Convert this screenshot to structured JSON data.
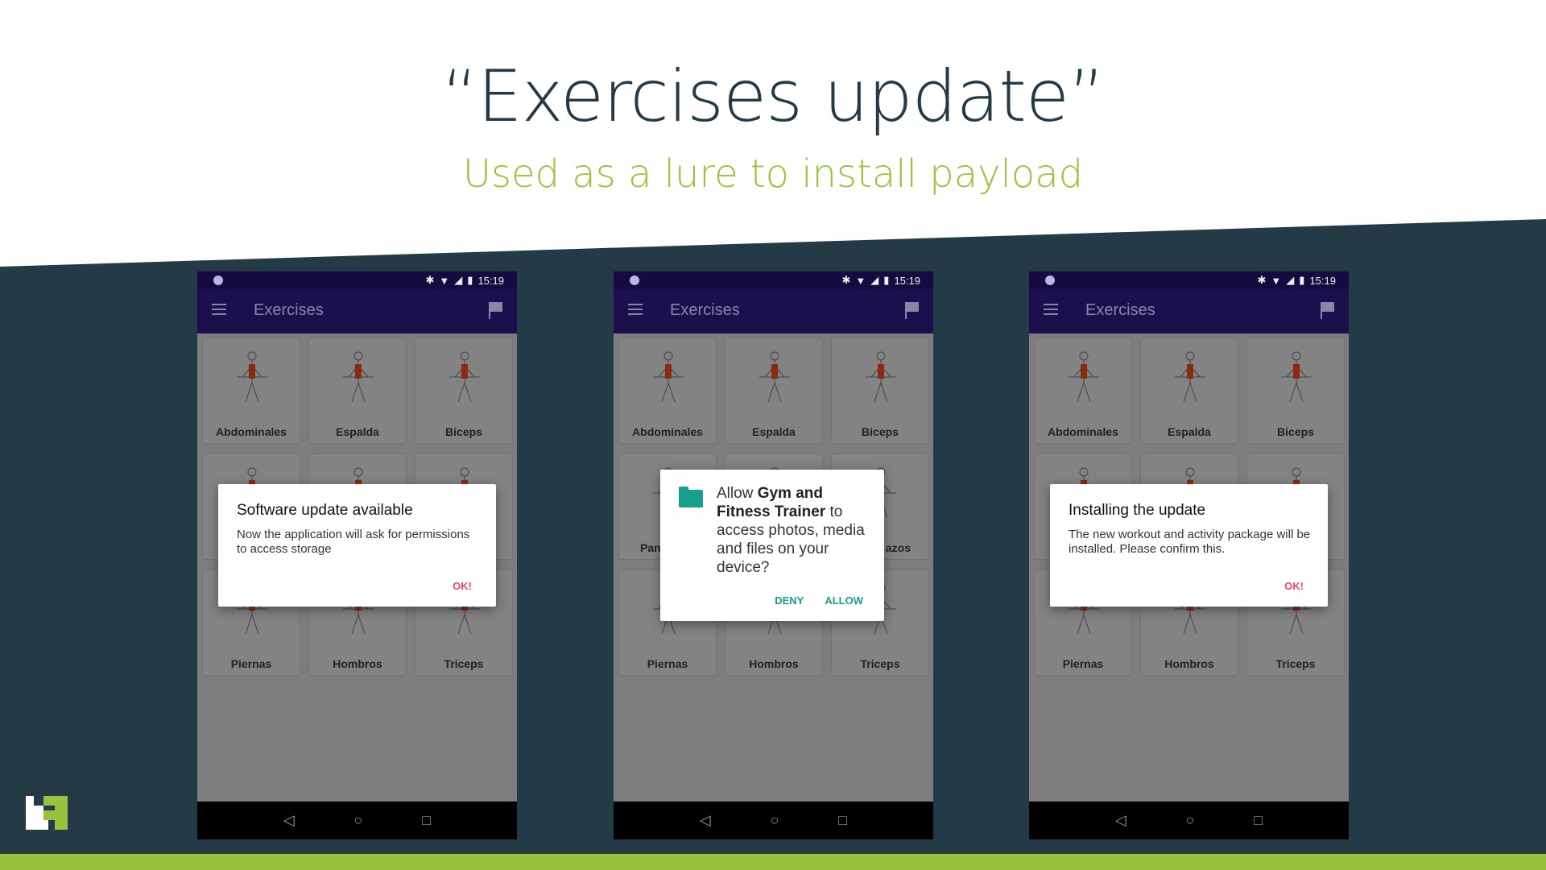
{
  "slide": {
    "title": "“Exercises update”",
    "subtitle": "Used as a lure to install payload",
    "colors": {
      "dark": "#243b47",
      "accent": "#9bc23c",
      "app_bar": "#1b0f4e"
    }
  },
  "phones": [
    {
      "status_time": "15:19",
      "app_title": "Exercises",
      "tiles": [
        {
          "label": "Abdominales"
        },
        {
          "label": "Espalda"
        },
        {
          "label": "Biceps"
        },
        {
          "label": ""
        },
        {
          "label": ""
        },
        {
          "label": ""
        },
        {
          "label": "Piernas"
        },
        {
          "label": "Hombros"
        },
        {
          "label": "Triceps"
        }
      ],
      "dialog": {
        "type": "alert",
        "title": "Software update available",
        "body": "Now the application will ask for permissions to access storage",
        "ok": "OK!"
      }
    },
    {
      "status_time": "15:19",
      "app_title": "Exercises",
      "tiles": [
        {
          "label": "Abdominales"
        },
        {
          "label": "Espalda"
        },
        {
          "label": "Biceps"
        },
        {
          "label": "Pan",
          "align": "l"
        },
        {
          "label": ""
        },
        {
          "label": "azos",
          "align": "r"
        },
        {
          "label": "Piernas"
        },
        {
          "label": "Hombros"
        },
        {
          "label": "Triceps"
        }
      ],
      "dialog": {
        "type": "permission",
        "pre": "Allow ",
        "app": "Gym and Fitness Trainer",
        "post": " to access photos, media and files on your device?",
        "deny": "DENY",
        "allow": "ALLOW"
      }
    },
    {
      "status_time": "15:19",
      "app_title": "Exercises",
      "tiles": [
        {
          "label": "Abdominales"
        },
        {
          "label": "Espalda"
        },
        {
          "label": "Biceps"
        },
        {
          "label": ""
        },
        {
          "label": ""
        },
        {
          "label": ""
        },
        {
          "label": "Piernas"
        },
        {
          "label": "Hombros"
        },
        {
          "label": "Triceps"
        }
      ],
      "dialog": {
        "type": "alert",
        "title": "Installing the update",
        "body": "The new workout and activity package will be installed. Please confirm this.",
        "ok": "OK!"
      }
    }
  ]
}
